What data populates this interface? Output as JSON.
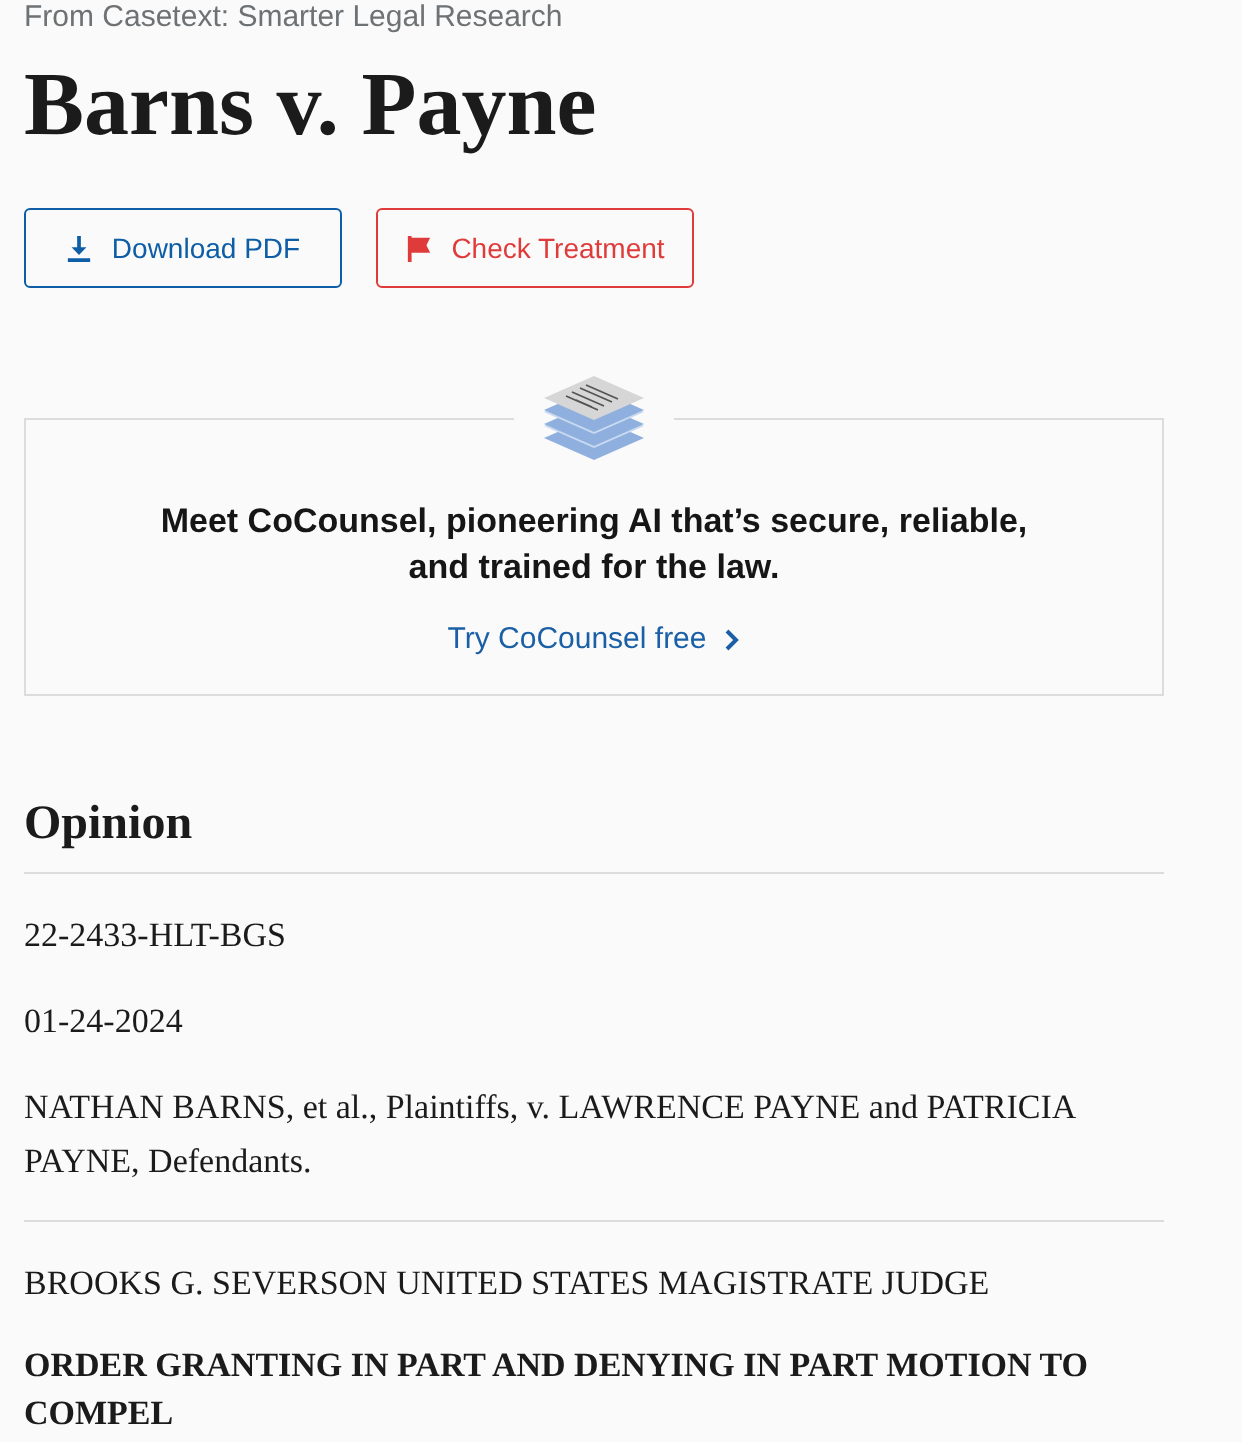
{
  "source": "From Casetext: Smarter Legal Research",
  "title": "Barns v. Payne",
  "actions": [
    {
      "kind": "download",
      "label": "Download PDF"
    },
    {
      "kind": "treatment",
      "label": "Check Treatment"
    }
  ],
  "promo": {
    "text": "Meet CoCounsel, pioneering AI that’s secure, reliable, and trained for the law.",
    "link": "Try CoCounsel free"
  },
  "opinion": {
    "heading": "Opinion",
    "sections": [
      {
        "paragraphs": [
          {
            "kind": "plain",
            "text": "22-2433-HLT-BGS"
          },
          {
            "kind": "plain",
            "text": "01-24-2024"
          },
          {
            "kind": "plain",
            "text": "NATHAN BARNS, et al., Plaintiffs, v. LAWRENCE PAYNE and PATRICIA PAYNE, Defendants."
          }
        ]
      },
      {
        "paragraphs": [
          {
            "kind": "plain",
            "text": "BROOKS G. SEVERSON UNITED STATES MAGISTRATE JUDGE"
          },
          {
            "kind": "heading",
            "text": "ORDER GRANTING IN PART AND DENYING IN PART MOTION TO COMPEL"
          }
        ]
      }
    ]
  }
}
